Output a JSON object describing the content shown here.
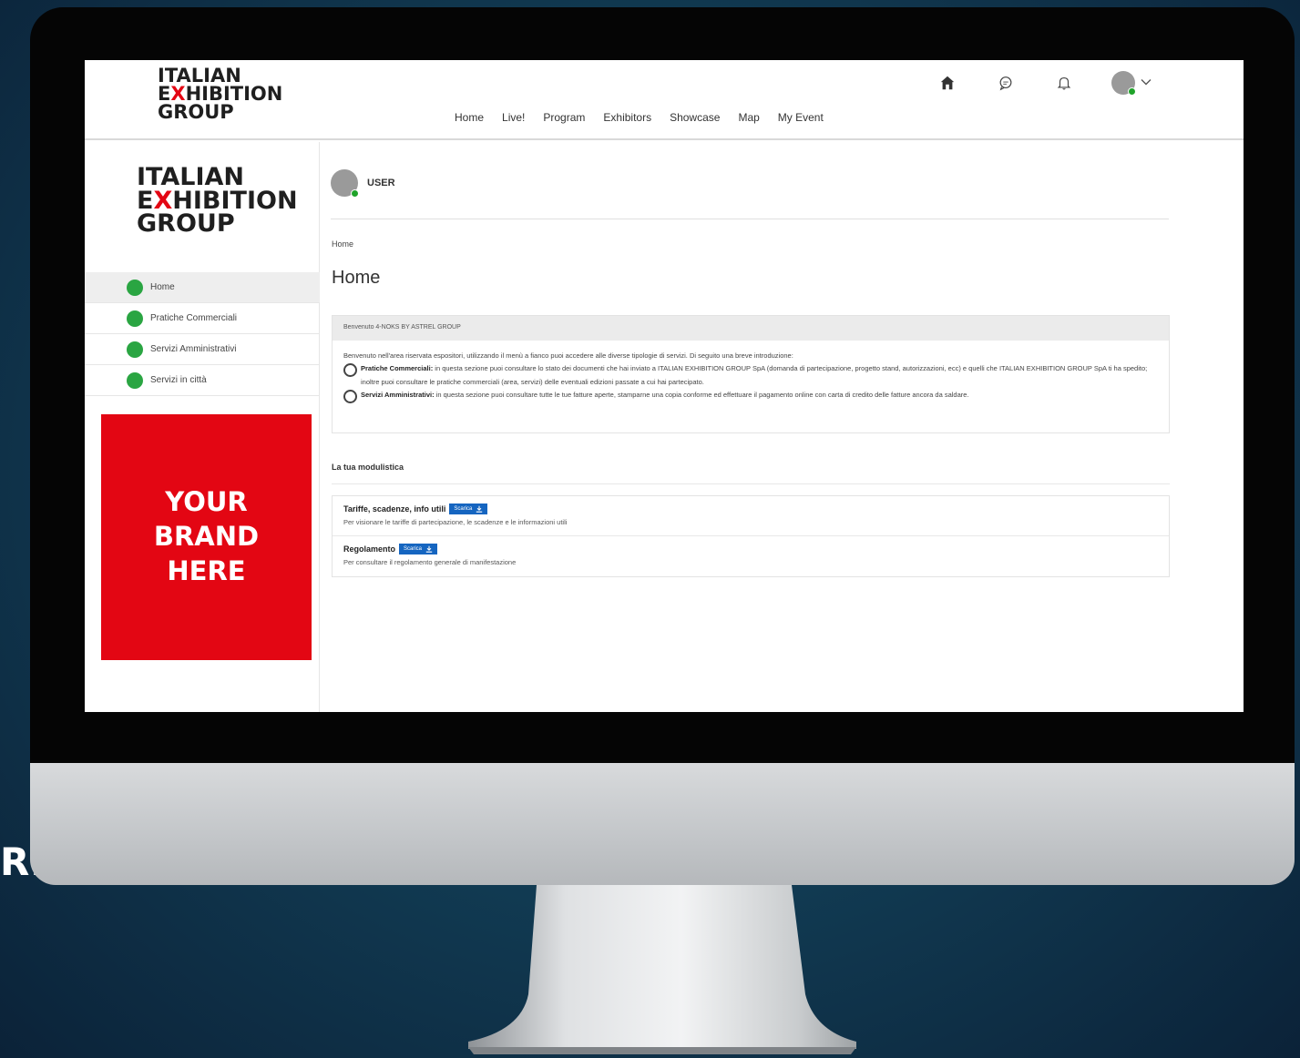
{
  "overlay_text": "REA",
  "logo": {
    "line1": "ITALIAN",
    "line2_e": "E",
    "line2_x": "X",
    "line2_rest": "HIBITION",
    "line3": "GROUP"
  },
  "nav": {
    "items": [
      "Home",
      "Live!",
      "Program",
      "Exhibitors",
      "Showcase",
      "Map",
      "My Event"
    ]
  },
  "header_icons": [
    "home-icon",
    "chat-icon",
    "bell-icon",
    "avatar"
  ],
  "sidebar": {
    "items": [
      {
        "label": "Home"
      },
      {
        "label": "Pratiche Commerciali"
      },
      {
        "label": "Servizi Amministrativi"
      },
      {
        "label": "Servizi in città"
      }
    ],
    "brand_lines": [
      "YOUR",
      "BRAND",
      "HERE"
    ]
  },
  "user": {
    "name": "USER"
  },
  "breadcrumb": "Home",
  "page_title": "Home",
  "welcome": {
    "heading": "Benvenuto 4-NOKS BY ASTREL GROUP",
    "intro": "Benvenuto nell'area riservata espositori, utilizzando il menù a fianco puoi accedere alle diverse tipologie di servizi. Di seguito una breve introduzione:",
    "items": [
      {
        "title": "Pratiche Commerciali:",
        "text": "in questa sezione puoi consultare lo stato dei documenti che hai inviato a ITALIAN EXHIBITION GROUP SpA (domanda di partecipazione, progetto stand, autorizzazioni, ecc) e quelli che ITALIAN EXHIBITION GROUP SpA ti ha spedito; inoltre puoi consultare le pratiche commerciali (area, servizi) delle eventuali edizioni passate a cui hai partecipato."
      },
      {
        "title": "Servizi Amministrativi:",
        "text": "in questa sezione puoi consultare tutte le tue fatture aperte, stamparne una copia conforme ed effettuare il pagamento online con carta di credito delle fatture ancora da saldare."
      }
    ]
  },
  "forms": {
    "title": "La tua modulistica",
    "download_label": "Scarica",
    "items": [
      {
        "title": "Tariffe, scadenze, info utili",
        "desc": "Per visionare le tariffe di partecipazione, le scadenze e le informazioni utili"
      },
      {
        "title": "Regolamento",
        "desc": "Per consultare il regolamento generale di manifestazione"
      }
    ]
  }
}
